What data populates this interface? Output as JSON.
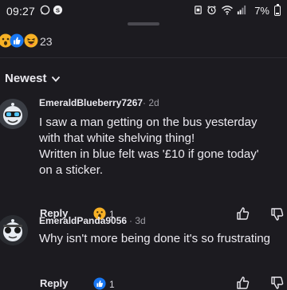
{
  "status_bar": {
    "time": "09:27",
    "battery": "7%"
  },
  "reactions": {
    "emojis": [
      "wow-emoji",
      "like-emoji",
      "haha-emoji"
    ],
    "count": "23"
  },
  "sort": {
    "label": "Newest"
  },
  "comments": [
    {
      "user": "EmeraldBlueberry7267",
      "time": "· 2d",
      "lines": [
        "I saw a man getting on the bus yesterday",
        "with that white shelving thing!",
        "Written in blue felt was '£10 if gone today'",
        "on a sticker."
      ],
      "reply_label": "Reply",
      "reaction_icon": "wow-emoji",
      "reaction_count": "1"
    },
    {
      "user": "EmeraldPanda9056",
      "time": "· 3d",
      "lines": [
        "Why isn't more being done it's so frustrating"
      ],
      "reply_label": "Reply",
      "reaction_icon": "like-emoji",
      "reaction_count": "1"
    }
  ],
  "colors": {
    "background": "#1c1b20",
    "like_blue": "#1877f2",
    "wow_yellow": "#f7b125"
  }
}
